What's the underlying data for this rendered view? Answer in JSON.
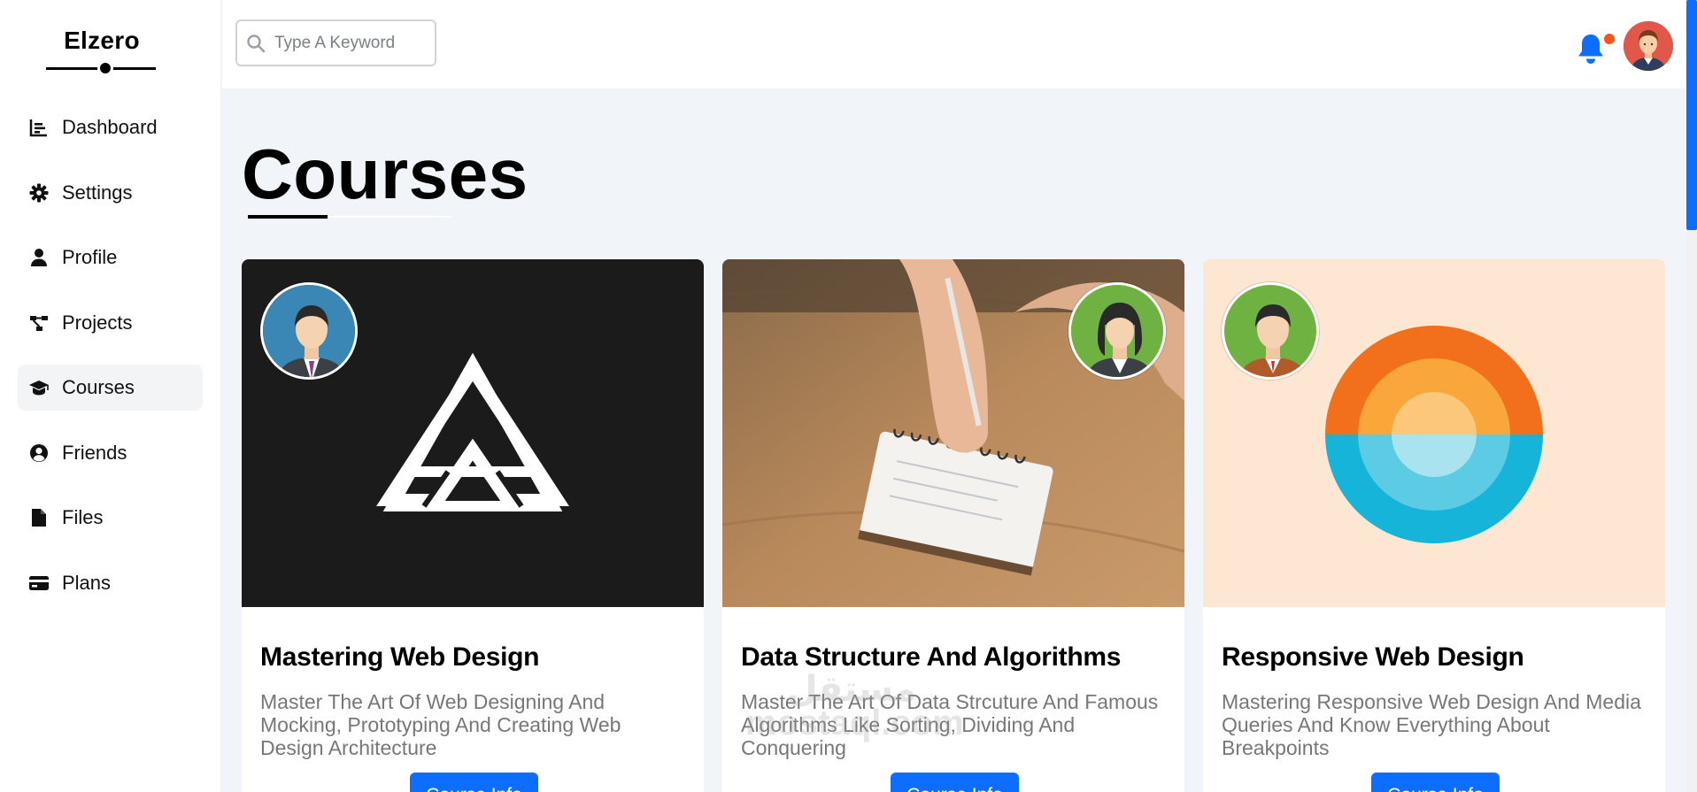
{
  "sidebar": {
    "brand": "Elzero",
    "items": [
      {
        "label": "Dashboard",
        "icon": "chart-bar-icon",
        "active": false
      },
      {
        "label": "Settings",
        "icon": "gear-icon",
        "active": false
      },
      {
        "label": "Profile",
        "icon": "user-icon",
        "active": false
      },
      {
        "label": "Projects",
        "icon": "diagram-project-icon",
        "active": false
      },
      {
        "label": "Courses",
        "icon": "graduation-cap-icon",
        "active": true
      },
      {
        "label": "Friends",
        "icon": "circle-user-icon",
        "active": false
      },
      {
        "label": "Files",
        "icon": "file-icon",
        "active": false
      },
      {
        "label": "Plans",
        "icon": "credit-card-icon",
        "active": false
      }
    ]
  },
  "header": {
    "search_placeholder": "Type A Keyword",
    "bell_icon": "bell-icon",
    "notification_dot_color": "#f5541c"
  },
  "main": {
    "title": "Courses",
    "courses": [
      {
        "title": "Mastering Web Design",
        "description": "Master The Art Of Web Designing And Mocking, Prototyping And Creating Web Design Architecture",
        "button_label": "Course Info",
        "media": "triangle-logo",
        "media_bg": "#1b1b1b"
      },
      {
        "title": "Data Structure And Algorithms",
        "description": "Master The Art Of Data Strcuture And Famous Algorithms Like Sorting, Dividing And Conquering",
        "button_label": "Course Info",
        "media": "hand-writing-notepad-photo",
        "media_bg": "#a77a4a"
      },
      {
        "title": "Responsive Web Design",
        "description": "Mastering Responsive Web Design And Media Queries And Know Everything About Breakpoints",
        "button_label": "Course Info",
        "media": "sunset-ocean-logo",
        "media_bg": "#fde7d2"
      }
    ]
  },
  "watermark": {
    "line1": "مستقل",
    "line2": "mostaql.com"
  },
  "colors": {
    "accent": "#0d6efd",
    "background": "#f1f5f9"
  }
}
